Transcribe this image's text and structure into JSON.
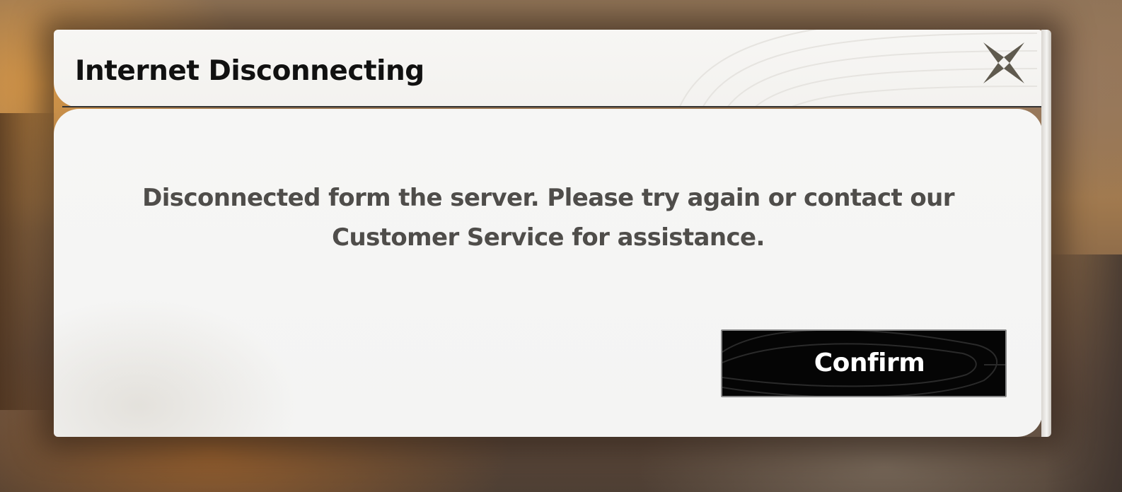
{
  "dialog": {
    "title": "Internet Disconnecting",
    "message_line1": "Disconnected form the server. Please try again or contact our",
    "message_line2": "Customer Service for assistance.",
    "confirm_label": "Confirm",
    "close_icon": "close-x-icon"
  },
  "colors": {
    "title": "#111111",
    "message": "#4f4d4a",
    "panel": "#f4f4f3",
    "button_bg": "#050505",
    "button_text": "#ffffff"
  }
}
